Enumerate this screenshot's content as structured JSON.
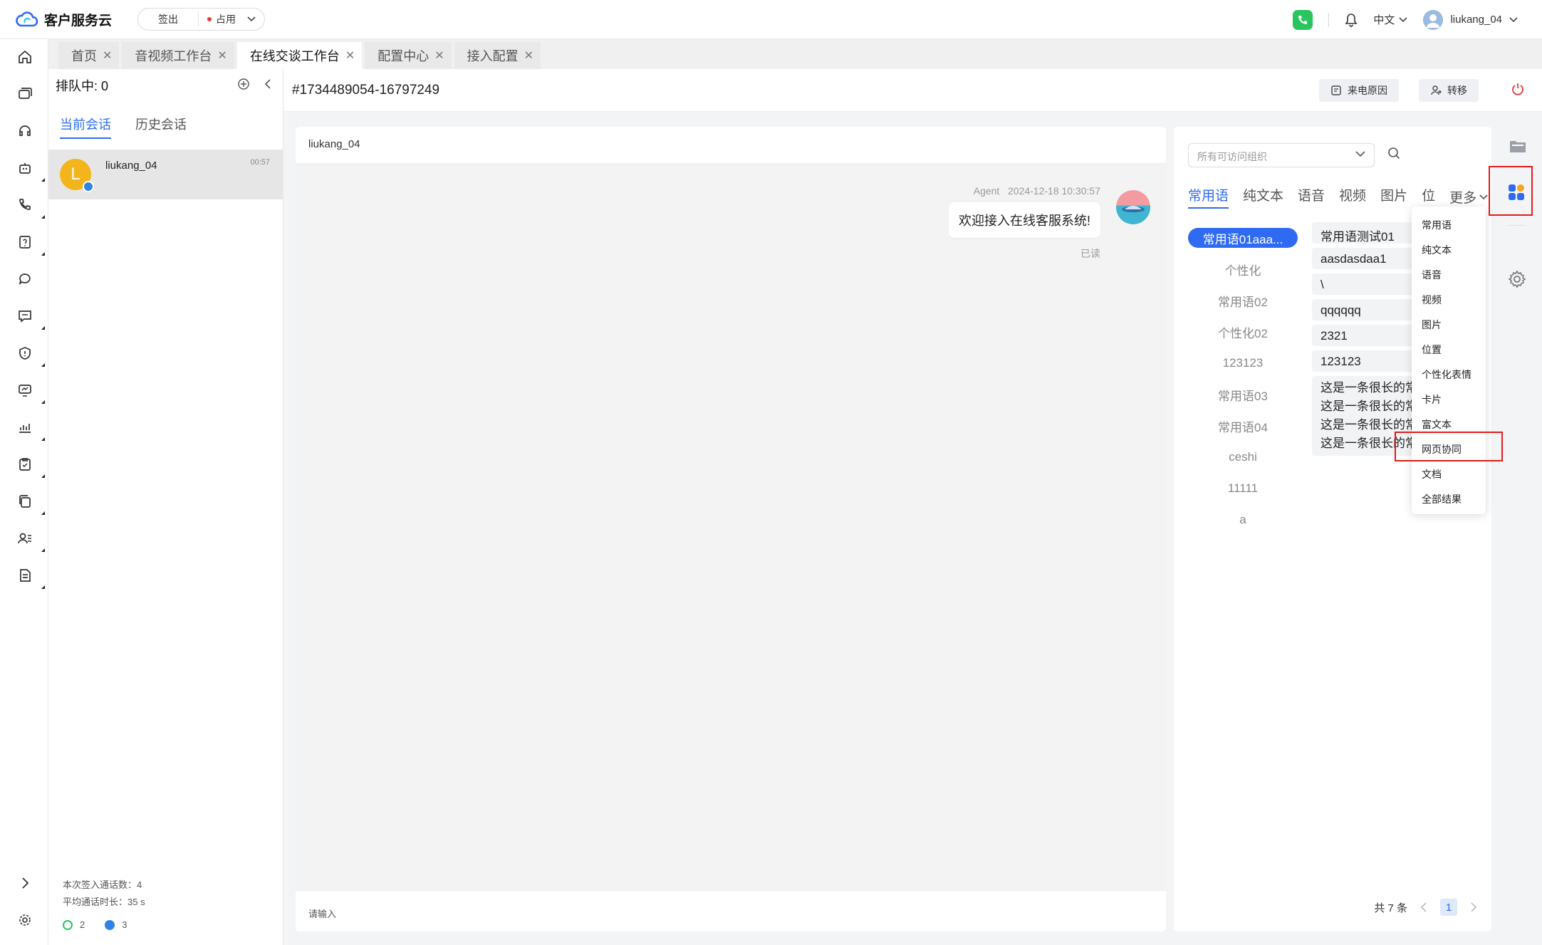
{
  "header": {
    "brand": "客户服务云",
    "signout_label": "签出",
    "status_label": "占用",
    "language": "中文",
    "username": "liukang_04"
  },
  "tabs": [
    {
      "label": "首页",
      "active": false
    },
    {
      "label": "音视频工作台",
      "active": false
    },
    {
      "label": "在线交谈工作台",
      "active": true
    },
    {
      "label": "配置中心",
      "active": false
    },
    {
      "label": "接入配置",
      "active": false
    }
  ],
  "sessions": {
    "queue_label": "排队中: 0",
    "subtabs": [
      "当前会话",
      "历史会话"
    ],
    "items": [
      {
        "avatar_letter": "L",
        "name": "liukang_04",
        "time": "00:57"
      }
    ],
    "stats": {
      "signin_count": "本次签入通话数：4",
      "avg_duration": "平均通话时长：35 s",
      "green_count": "2",
      "blue_count": "3"
    }
  },
  "chat": {
    "conversation_id": "#1734489054-16797249",
    "reason_button": "来电原因",
    "transfer_button": "转移",
    "customer_name": "liukang_04",
    "messages": [
      {
        "sender": "Agent",
        "time": "2024-12-18 10:30:57",
        "text": "欢迎接入在线客服系统!",
        "status": "已读"
      }
    ],
    "input_placeholder": "请输入"
  },
  "phrase_panel": {
    "org_placeholder": "所有可访问组织",
    "tabs": [
      "常用语",
      "纯文本",
      "语音",
      "视频",
      "图片",
      "位"
    ],
    "more_label": "更多",
    "groups": [
      "常用语01aaa...",
      "个性化",
      "常用语02",
      "个性化02",
      "123123",
      "常用语03",
      "常用语04",
      "ceshi",
      "11111",
      "a"
    ],
    "phrases": [
      "常用语测试01",
      "aasdasdaa1",
      "\\",
      "qqqqqq",
      "2321",
      "123123"
    ],
    "long_phrase_lines": [
      "这是一条很长的常",
      "这是一条很长的常",
      "这是一条很长的常",
      "这是一条很长的常"
    ],
    "total": "共 7 条",
    "page": "1"
  },
  "more_menu": {
    "items": [
      "常用语",
      "纯文本",
      "语音",
      "视频",
      "图片",
      "位置",
      "个性化表情",
      "卡片",
      "富文本",
      "网页协同",
      "文档",
      "全部结果"
    ],
    "highlighted": "网页协同"
  },
  "colors": {
    "accent": "#2f6bf2",
    "highlight": "#e31b1b",
    "phone": "#2bc55f"
  }
}
